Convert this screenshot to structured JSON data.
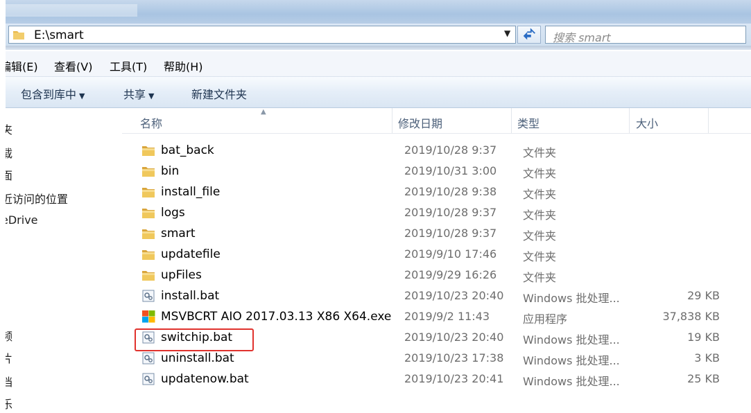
{
  "address": {
    "path": "E:\\smart"
  },
  "search": {
    "placeholder": "搜索 smart"
  },
  "menu": [
    "编辑(E)",
    "查看(V)",
    "工具(T)",
    "帮助(H)"
  ],
  "toolbar": {
    "include": "包含到库中",
    "share": "共享",
    "new_folder": "新建文件夹"
  },
  "nav": [
    "夹",
    "载",
    "面",
    "近访问的位置",
    "eDrive",
    "频",
    "片",
    "档",
    "乐"
  ],
  "columns": {
    "name": "名称",
    "date": "修改日期",
    "type": "类型",
    "size": "大小"
  },
  "files": [
    {
      "name": "bat_back",
      "date": "2019/10/28 9:37",
      "type": "文件夹",
      "size": "",
      "icon": "folder-icon"
    },
    {
      "name": "bin",
      "date": "2019/10/31 3:00",
      "type": "文件夹",
      "size": "",
      "icon": "folder-icon"
    },
    {
      "name": "install_file",
      "date": "2019/10/28 9:38",
      "type": "文件夹",
      "size": "",
      "icon": "folder-icon"
    },
    {
      "name": "logs",
      "date": "2019/10/28 9:37",
      "type": "文件夹",
      "size": "",
      "icon": "folder-icon"
    },
    {
      "name": "smart",
      "date": "2019/10/28 9:37",
      "type": "文件夹",
      "size": "",
      "icon": "folder-icon"
    },
    {
      "name": "updatefile",
      "date": "2019/9/10 17:46",
      "type": "文件夹",
      "size": "",
      "icon": "folder-icon"
    },
    {
      "name": "upFiles",
      "date": "2019/9/29 16:26",
      "type": "文件夹",
      "size": "",
      "icon": "folder-icon"
    },
    {
      "name": "install.bat",
      "date": "2019/10/23 20:40",
      "type": "Windows 批处理...",
      "size": "29 KB",
      "icon": "batch-file-icon"
    },
    {
      "name": "MSVBCRT AIO 2017.03.13 X86 X64.exe",
      "date": "2019/9/2 11:43",
      "type": "应用程序",
      "size": "37,838 KB",
      "icon": "windows-exe-icon"
    },
    {
      "name": "switchip.bat",
      "date": "2019/10/23 20:40",
      "type": "Windows 批处理...",
      "size": "19 KB",
      "icon": "batch-file-icon"
    },
    {
      "name": "uninstall.bat",
      "date": "2019/10/23 17:38",
      "type": "Windows 批处理...",
      "size": "3 KB",
      "icon": "batch-file-icon"
    },
    {
      "name": "updatenow.bat",
      "date": "2019/10/23 20:41",
      "type": "Windows 批处理...",
      "size": "25 KB",
      "icon": "batch-file-icon"
    }
  ],
  "highlight_color": "#e0322d",
  "folder_color": "#e8b84a"
}
